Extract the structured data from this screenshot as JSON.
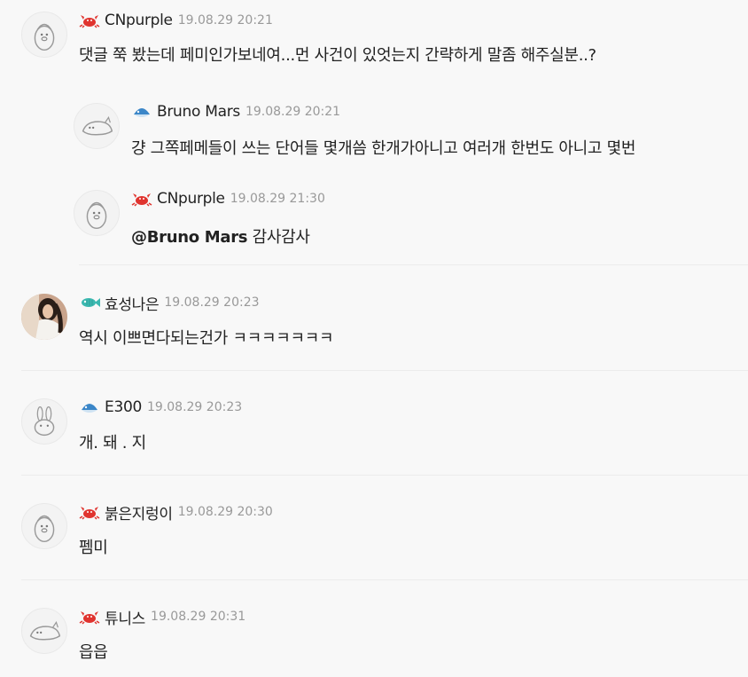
{
  "comments": [
    {
      "nick": "CNpurple",
      "time": "19.08.29 20:21",
      "text": "댓글 쭉 봤는데 페미인가보네여...먼 사건이 있엇는지 간략하게 말좀 해주실분..?",
      "badge": "crab-icon",
      "avatar": "penguin-avatar"
    },
    {
      "nick": "Bruno Mars",
      "time": "19.08.29 20:21",
      "text": "걍 그쪽페메들이 쓰는 단어들 몇개씀 한개가아니고 여러개 한번도 아니고 몇번",
      "badge": "pufferfish-icon",
      "avatar": "seal-avatar"
    },
    {
      "nick": "CNpurple",
      "time": "19.08.29 21:30",
      "mention": "@Bruno Mars",
      "text": " 감사감사",
      "badge": "crab-icon",
      "avatar": "penguin-avatar"
    },
    {
      "nick": "효성나은",
      "time": "19.08.29 20:23",
      "text": "역시 이쁘면다되는건가 ㅋㅋㅋㅋㅋㅋㅋ",
      "badge": "fish-icon",
      "avatar": "photo-avatar"
    },
    {
      "nick": "E300",
      "time": "19.08.29 20:23",
      "text": "개. 돼 . 지",
      "badge": "pufferfish-icon",
      "avatar": "rabbit-avatar"
    },
    {
      "nick": "붉은지렁이",
      "time": "19.08.29 20:30",
      "text": "펨미",
      "badge": "crab-icon",
      "avatar": "penguin-avatar"
    },
    {
      "nick": "튜니스",
      "time": "19.08.29 20:31",
      "text": "읍읍",
      "badge": "crab-icon",
      "avatar": "seal-avatar"
    }
  ],
  "colors": {
    "crab": "#e0342f",
    "pufferfish": "#3b86c8",
    "fish": "#3bb8b0",
    "nick": "#222222",
    "time": "#999999"
  }
}
